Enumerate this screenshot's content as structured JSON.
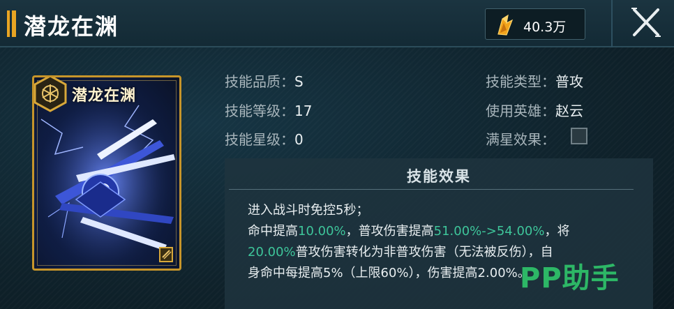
{
  "header": {
    "title": "潜龙在渊",
    "currency": {
      "icon": "gold-crystal-icon",
      "value": "40.3万"
    },
    "close_icon": "close-icon"
  },
  "card": {
    "name": "潜龙在渊",
    "emblem_icon": "skill-emblem-icon",
    "corner_icon": "card-tag-icon",
    "frame_color": "#c7952a"
  },
  "info": {
    "quality_label": "技能品质：",
    "quality_value": "S",
    "level_label": "技能等级：",
    "level_value": "17",
    "star_label": "技能星级：",
    "star_value": "0",
    "type_label": "技能类型：",
    "type_value": "普攻",
    "hero_label": "使用英雄：",
    "hero_value": "赵云",
    "fullstar_label": "满星效果："
  },
  "effect": {
    "title": "技能效果",
    "line1": "进入战斗时免控5秒；",
    "l2_a": "命中提高",
    "l2_b": "10.00%",
    "l2_c": "，普攻伤害提高",
    "l2_d": "51.00%->54.00%",
    "l2_e": "，将",
    "l3_a": "20.00%",
    "l3_b": "普攻伤害转化为非普攻伤害（无法被反伤），自",
    "l4": "身命中每提高5%（上限60%），伤害提高2.00%。",
    "highlight_color": "#3ec59a"
  },
  "watermark": "PP助手"
}
